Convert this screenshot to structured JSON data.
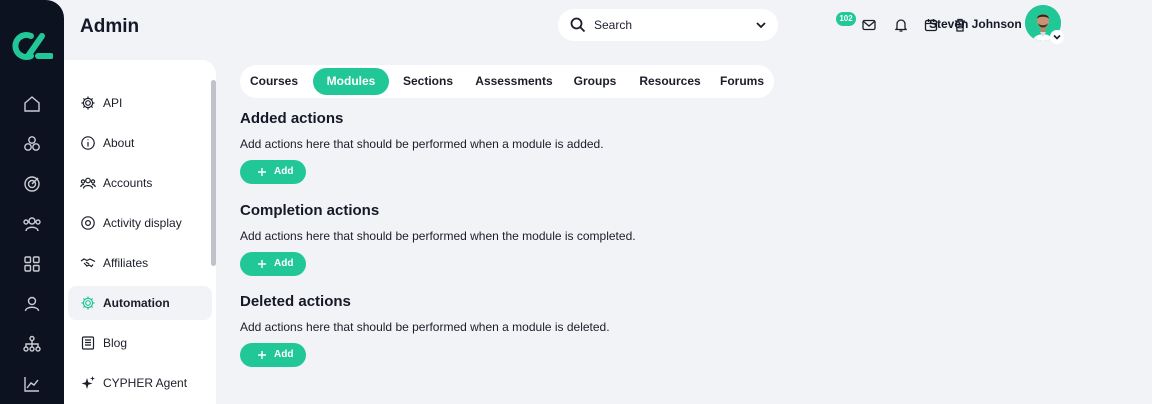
{
  "header": {
    "title": "Admin",
    "search": {
      "placeholder": "Search"
    },
    "notifications": {
      "count": "102"
    },
    "user": {
      "name": "Steven Johnson"
    }
  },
  "rail": {
    "icons": [
      "home-icon",
      "cubes-icon",
      "target-icon",
      "users-icon",
      "grid-icon",
      "user-icon",
      "sitemap-icon",
      "chart-icon"
    ]
  },
  "sidebar": {
    "items": [
      {
        "label": "API",
        "icon": "gear-icon"
      },
      {
        "label": "About",
        "icon": "info-icon"
      },
      {
        "label": "Accounts",
        "icon": "users-icon"
      },
      {
        "label": "Activity display",
        "icon": "record-icon"
      },
      {
        "label": "Affiliates",
        "icon": "handshake-icon"
      },
      {
        "label": "Automation",
        "icon": "gear-icon",
        "active": true
      },
      {
        "label": "Blog",
        "icon": "document-icon"
      },
      {
        "label": "CYPHER Agent",
        "icon": "sparkle-icon"
      }
    ]
  },
  "tabs": [
    {
      "label": "Courses"
    },
    {
      "label": "Modules",
      "active": true
    },
    {
      "label": "Sections"
    },
    {
      "label": "Assessments"
    },
    {
      "label": "Groups"
    },
    {
      "label": "Resources"
    },
    {
      "label": "Forums"
    }
  ],
  "sections": [
    {
      "title": "Added actions",
      "description": "Add actions here that should be performed when a module is added.",
      "button": "Add"
    },
    {
      "title": "Completion actions",
      "description": "Add actions here that should be performed when the module is completed.",
      "button": "Add"
    },
    {
      "title": "Deleted actions",
      "description": "Add actions here that should be performed when a module is deleted.",
      "button": "Add"
    }
  ],
  "colors": {
    "accent": "#22c797",
    "rail": "#0d1220",
    "background": "#f2f3f7"
  }
}
